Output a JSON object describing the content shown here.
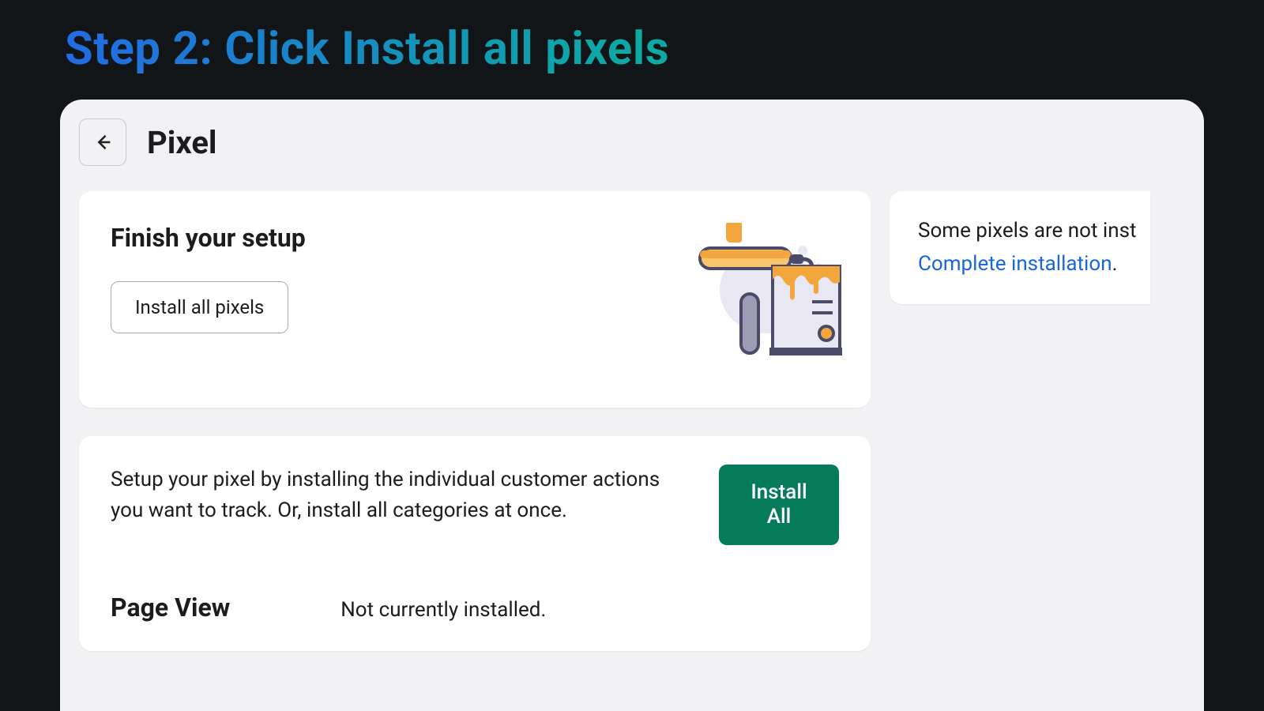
{
  "step": {
    "title": "Step 2: Click Install all pixels"
  },
  "header": {
    "page_title": "Pixel"
  },
  "setup": {
    "title": "Finish your setup",
    "install_button": "Install all pixels"
  },
  "actions": {
    "description": "Setup your pixel by installing the individual customer actions you want to track. Or, install all categories at once.",
    "install_all_button": "Install All"
  },
  "pixels": [
    {
      "name": "Page View",
      "status": "Not currently installed."
    }
  ],
  "notice": {
    "text": "Some pixels are not inst",
    "link": "Complete installation",
    "period": "."
  }
}
